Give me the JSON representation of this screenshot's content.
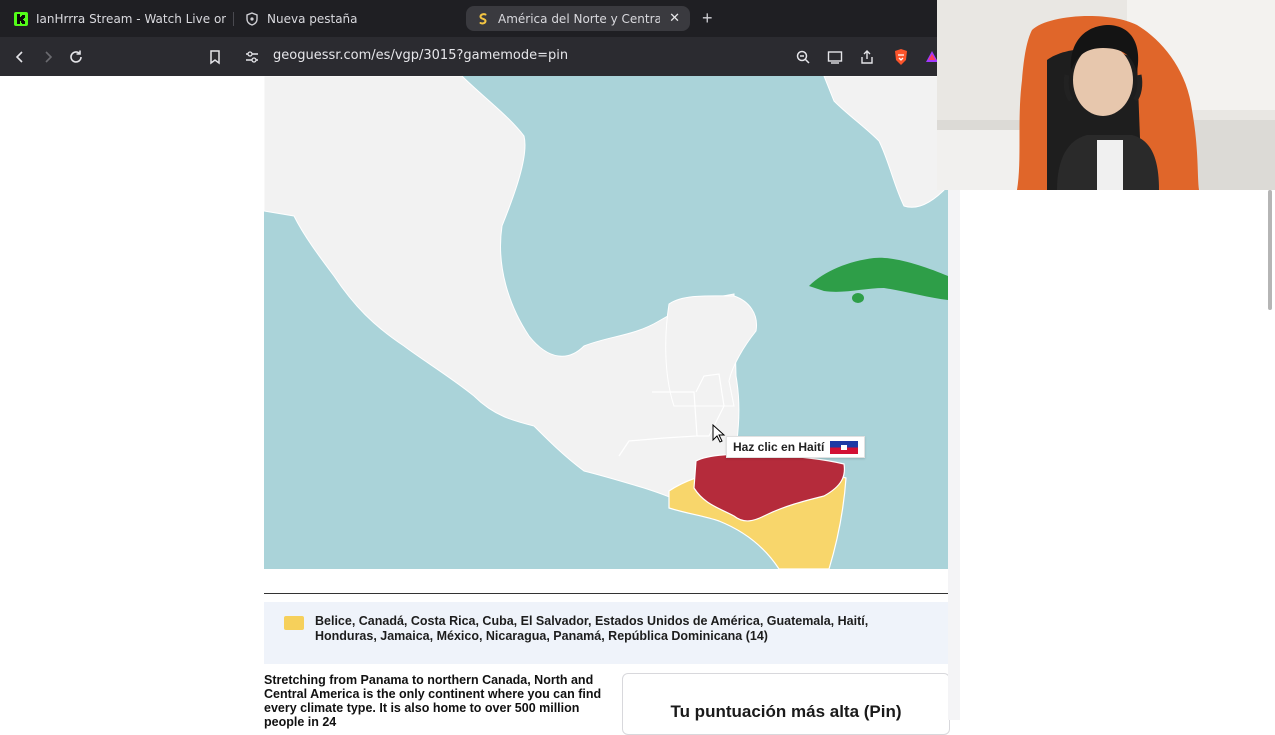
{
  "browser": {
    "tabs": [
      {
        "title": "IanHrrra Stream - Watch Live on Kick",
        "icon": "kick-icon"
      },
      {
        "title": "Nueva pestaña",
        "icon": "brave-shield-icon"
      },
      {
        "title": "América del Norte y Central: Paí",
        "icon": "seterra-icon",
        "active": true
      }
    ],
    "url": "geoguessr.com/es/vgp/3015?gamemode=pin"
  },
  "game": {
    "prompt": "Haz clic en Haití",
    "countries_list": "Belice, Canadá, Costa Rica, Cuba, El Salvador, Estados Unidos de América, Guatemala, Haití, Honduras, Jamaica, México, Nicaragua, Panamá, República Dominicana (14)",
    "description": "Stretching from Panama to northern Canada, North and Central America is the only continent where you can find every climate type. It is also home to over 500 million people in 24",
    "score_title": "Tu puntuación más alta (Pin)",
    "colors": {
      "water": "#aad3d9",
      "land": "#f2f2f2",
      "correct": "#2e9e48",
      "highlight": "#b52b3b",
      "neighbor": "#f8d66b"
    }
  }
}
